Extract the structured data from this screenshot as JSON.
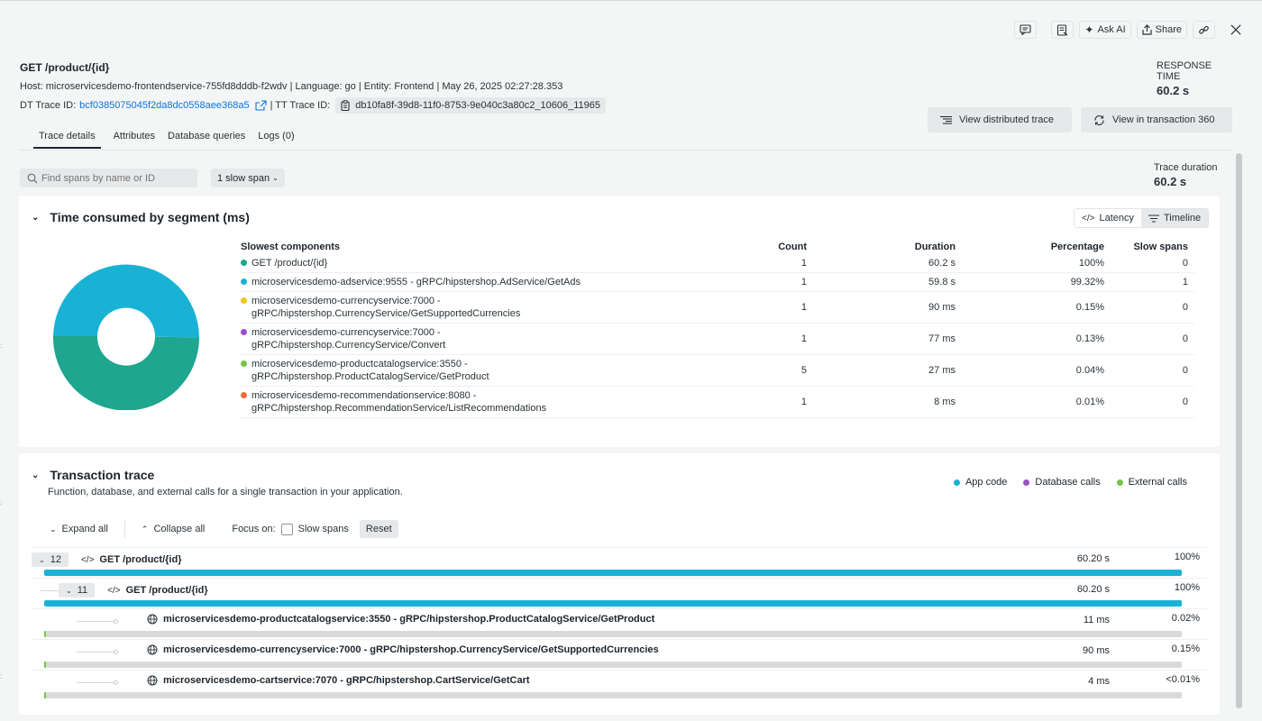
{
  "top_actions": {
    "comment_icon": "comment-icon",
    "notes_icon": "notes-icon",
    "ask_ai": "Ask AI",
    "share": "Share",
    "link_icon": "link-icon",
    "close_icon": "close-icon"
  },
  "header": {
    "title": "GET /product/{id}",
    "meta": "Host: microservicesdemo-frontendservice-755fd8dddb-f2wdv | Language: go | Entity: Frontend | May 26, 2025 02:27:28.353",
    "dt_trace_label": "DT Trace ID:",
    "dt_trace_id": "bcf0385075045f2da8dc0558aee368a5",
    "tt_trace_label": "| TT Trace ID:",
    "tt_trace_id": "db10fa8f-39d8-11f0-8753-9e040c3a80c2_10606_11965",
    "response_time_label": "RESPONSE TIME",
    "response_time_value": "60.2 s",
    "view_distributed": "View distributed trace",
    "view_transaction": "View in transaction 360"
  },
  "tabs": [
    "Trace details",
    "Attributes",
    "Database queries",
    "Logs (0)"
  ],
  "toolbar": {
    "search_placeholder": "Find spans by name or ID",
    "slow_span_filter": "1 slow span",
    "trace_duration_label": "Trace duration",
    "trace_duration_value": "60.2 s"
  },
  "segment_section": {
    "title": "Time consumed by segment (ms)",
    "toggle_latency": "Latency",
    "toggle_timeline": "Timeline",
    "headers": {
      "name": "Slowest components",
      "count": "Count",
      "duration": "Duration",
      "percentage": "Percentage",
      "slow": "Slow spans"
    },
    "rows": [
      {
        "name": "GET /product/{id}",
        "name2": "",
        "count": "1",
        "duration": "60.2 s",
        "percentage": "100%",
        "slow": "0",
        "color": "#1fa68f"
      },
      {
        "name": "microservicesdemo-adservice:9555 - gRPC/hipstershop.AdService/GetAds",
        "name2": "",
        "count": "1",
        "duration": "59.8 s",
        "percentage": "99.32%",
        "slow": "1",
        "color": "#1ab2d4"
      },
      {
        "name": "microservicesdemo-currencyservice:7000 -",
        "name2": "gRPC/hipstershop.CurrencyService/GetSupportedCurrencies",
        "count": "1",
        "duration": "90 ms",
        "percentage": "0.15%",
        "slow": "0",
        "color": "#f5c518"
      },
      {
        "name": "microservicesdemo-currencyservice:7000 -",
        "name2": "gRPC/hipstershop.CurrencyService/Convert",
        "count": "1",
        "duration": "77 ms",
        "percentage": "0.13%",
        "slow": "0",
        "color": "#9b4fc4"
      },
      {
        "name": "microservicesdemo-productcatalogservice:3550 -",
        "name2": "gRPC/hipstershop.ProductCatalogService/GetProduct",
        "count": "5",
        "duration": "27 ms",
        "percentage": "0.04%",
        "slow": "0",
        "color": "#76c348"
      },
      {
        "name": "microservicesdemo-recommendationservice:8080 -",
        "name2": "gRPC/hipstershop.RecommendationService/ListRecommendations",
        "count": "1",
        "duration": "8 ms",
        "percentage": "0.01%",
        "slow": "0",
        "color": "#f06b3a"
      }
    ]
  },
  "chart_data": {
    "type": "pie",
    "categories": [
      "GET /product/{id}",
      "microservicesdemo-adservice:9555 - gRPC/hipstershop.AdService/GetAds"
    ],
    "values": [
      50.3,
      49.7
    ],
    "colors": [
      "#1fa68f",
      "#1ab2d4"
    ]
  },
  "trace_section": {
    "title": "Transaction trace",
    "subtitle": "Function, database, and external calls for a single transaction in your application.",
    "legend": [
      {
        "label": "App code",
        "color": "#1ab2d4"
      },
      {
        "label": "Database calls",
        "color": "#9b4fc4"
      },
      {
        "label": "External calls",
        "color": "#76c348"
      }
    ],
    "expand_all": "Expand all",
    "collapse_all": "Collapse all",
    "focus_on": "Focus on:",
    "slow_spans": "Slow spans",
    "reset": "Reset",
    "rows": [
      {
        "count": "12",
        "name": "GET /product/{id}",
        "duration": "60.20 s",
        "percentage": "100%",
        "fill": 1.0,
        "color": "#1ab2d4"
      },
      {
        "count": "11",
        "name": "GET /product/{id}",
        "duration": "60.20 s",
        "percentage": "100%",
        "fill": 1.0,
        "color": "#1ab2d4"
      },
      {
        "count": "",
        "name": "microservicesdemo-productcatalogservice:3550 - gRPC/hipstershop.ProductCatalogService/GetProduct",
        "duration": "11 ms",
        "percentage": "0.02%",
        "fill": 0.0002,
        "color": "#76c348"
      },
      {
        "count": "",
        "name": "microservicesdemo-currencyservice:7000 - gRPC/hipstershop.CurrencyService/GetSupportedCurrencies",
        "duration": "90 ms",
        "percentage": "0.15%",
        "fill": 0.0015,
        "color": "#76c348"
      },
      {
        "count": "",
        "name": "microservicesdemo-cartservice:7070 - gRPC/hipstershop.CartService/GetCart",
        "duration": "4 ms",
        "percentage": "<0.01%",
        "fill": 0.0001,
        "color": "#76c348"
      }
    ]
  }
}
